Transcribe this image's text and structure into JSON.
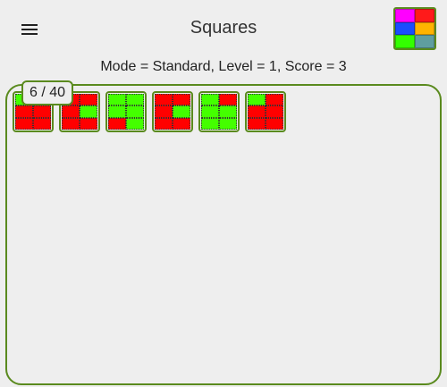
{
  "header": {
    "title": "Squares",
    "menu_icon": "hamburger-menu-icon",
    "logo_colors": [
      "#ff00ff",
      "#ff1a1a",
      "#1a4dff",
      "#ffb300",
      "#33ff00",
      "#5f9ea0"
    ]
  },
  "status": {
    "text": "Mode = Standard, Level = 1, Score = 3"
  },
  "board": {
    "counter": "6 / 40",
    "colors": {
      "r": "#ff0000",
      "g": "#44ff00",
      "border": "#5a8a1e"
    },
    "pieces": [
      [
        "g",
        "g",
        "r",
        "r",
        "r",
        "r"
      ],
      [
        "r",
        "r",
        "r",
        "g",
        "r",
        "r"
      ],
      [
        "g",
        "g",
        "g",
        "g",
        "r",
        "g"
      ],
      [
        "r",
        "r",
        "r",
        "g",
        "r",
        "r"
      ],
      [
        "g",
        "r",
        "g",
        "g",
        "g",
        "g"
      ],
      [
        "g",
        "r",
        "r",
        "r",
        "r",
        "r"
      ]
    ]
  }
}
